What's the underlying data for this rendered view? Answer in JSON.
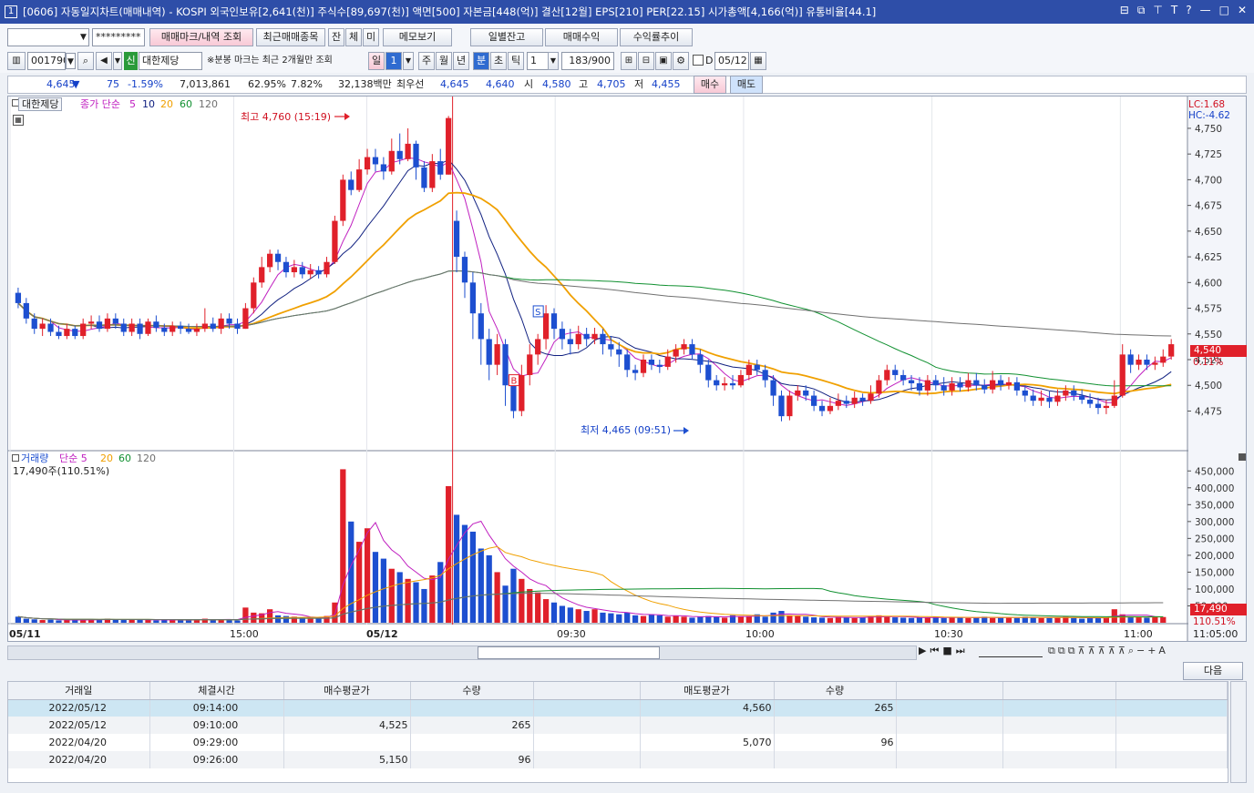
{
  "title_bar": {
    "window_number": "1",
    "title": "[0606] 자동일지차트(매매내역) - KOSPI 외국인보유[2,641(천)] 주식수[89,697(천)] 액면[500] 자본금[448(억)] 결산[12월] EPS[210] PER[22.15] 시가총액[4,166(억)] 유통비율[44.1]",
    "controls": [
      "⊟",
      "⧉",
      "⊤",
      "T",
      "?",
      "—",
      "□",
      "✕"
    ]
  },
  "toolbar1": {
    "account_value": "",
    "password_mask": "*********",
    "buttons": [
      "매매마크/내역 조회",
      "최근매매종목",
      "잔",
      "체",
      "미",
      "메모보기",
      "일별잔고",
      "매매수익",
      "수익률추이"
    ]
  },
  "toolbar2": {
    "stock_code": "001790",
    "stock_badge": "신",
    "stock_name": "대한제당",
    "note": "※분봉 마크는 최근 2개월만 조회",
    "periods": [
      "일",
      "1",
      "주",
      "월",
      "년",
      "분",
      "초",
      "틱",
      "1"
    ],
    "count": "183/900",
    "d_label": "D",
    "date": "05/12"
  },
  "quote": {
    "price": "4,645",
    "arrow": "▼",
    "change": "75",
    "change_pct": "-1.59%",
    "volume": "7,013,861",
    "ratio": "62.95%",
    "turnover": "7.82%",
    "amount": "32,138백만",
    "best_label": "최우선",
    "best_ask": "4,645",
    "best_bid": "4,640",
    "open_label": "시",
    "open": "4,580",
    "high_label": "고",
    "high": "4,705",
    "low_label": "저",
    "low": "4,455",
    "buy_btn": "매수",
    "sell_btn": "매도"
  },
  "price_panel": {
    "stock_tab": "대한제당",
    "legend_prefix": "종가 단순",
    "legend_ma": [
      "5",
      "10",
      "20",
      "60",
      "120"
    ],
    "lc": "LC:1.68",
    "hc": "HC:-4.62",
    "high_marker": "최고 4,760 (15:19)",
    "low_marker": "최저 4,465 (09:51)",
    "current_price": "4,540",
    "current_pct": "0.11%",
    "buy_mark": "B",
    "sell_mark": "S"
  },
  "volume_panel": {
    "legend_prefix": "거래량",
    "legend_ma": [
      "단순 5",
      "20",
      "60",
      "120"
    ],
    "info": "17,490주(110.51%)",
    "current_vol": "17,490",
    "current_pct": "110.51%"
  },
  "time_axis": [
    "05/11",
    "15:00",
    "05/12",
    "09:30",
    "10:00",
    "10:30",
    "11:00",
    "11:05:00"
  ],
  "bottom": {
    "next_btn": "다음"
  },
  "trade_table": {
    "headers": [
      "거래일",
      "체결시간",
      "매수평균가",
      "수량",
      "",
      "매도평균가",
      "수량",
      "",
      "",
      ""
    ],
    "rows": [
      [
        "2022/05/12",
        "09:14:00",
        "",
        "",
        "",
        "4,560",
        "265",
        "",
        "",
        ""
      ],
      [
        "2022/05/12",
        "09:10:00",
        "4,525",
        "265",
        "",
        "",
        "",
        "",
        "",
        ""
      ],
      [
        "2022/04/20",
        "09:29:00",
        "",
        "",
        "",
        "5,070",
        "96",
        "",
        "",
        ""
      ],
      [
        "2022/04/20",
        "09:26:00",
        "5,150",
        "96",
        "",
        "",
        "",
        "",
        "",
        ""
      ]
    ]
  },
  "chart_data": {
    "type": "candlestick",
    "price_axis": {
      "ticks": [
        4475,
        4500,
        4525,
        4550,
        4575,
        4600,
        4625,
        4650,
        4675,
        4700,
        4725,
        4750
      ],
      "ylim": [
        4440,
        4765
      ]
    },
    "volume_axis": {
      "ticks": [
        50000,
        100000,
        150000,
        200000,
        250000,
        300000,
        350000,
        400000,
        450000
      ],
      "ylim": [
        0,
        475000
      ]
    },
    "colors": {
      "up": "#e0202a",
      "down": "#1d4fd0",
      "ma5": "#c020c0",
      "ma10": "#102080",
      "ma20": "#f0a000",
      "ma60": "#109030",
      "ma120": "#707070"
    },
    "candles": [
      [
        4590,
        4580,
        4595,
        4575
      ],
      [
        4580,
        4565,
        4585,
        4560
      ],
      [
        4565,
        4555,
        4570,
        4550
      ],
      [
        4555,
        4560,
        4565,
        4548
      ],
      [
        4560,
        4552,
        4565,
        4548
      ],
      [
        4552,
        4548,
        4558,
        4545
      ],
      [
        4548,
        4555,
        4560,
        4545
      ],
      [
        4555,
        4548,
        4558,
        4545
      ],
      [
        4548,
        4560,
        4565,
        4545
      ],
      [
        4560,
        4562,
        4568,
        4555
      ],
      [
        4562,
        4555,
        4568,
        4552
      ],
      [
        4555,
        4565,
        4570,
        4552
      ],
      [
        4565,
        4560,
        4570,
        4555
      ],
      [
        4560,
        4552,
        4565,
        4548
      ],
      [
        4552,
        4560,
        4565,
        4548
      ],
      [
        4560,
        4550,
        4565,
        4545
      ],
      [
        4550,
        4562,
        4565,
        4548
      ],
      [
        4562,
        4556,
        4568,
        4552
      ],
      [
        4556,
        4552,
        4560,
        4548
      ],
      [
        4552,
        4558,
        4562,
        4548
      ],
      [
        4558,
        4555,
        4562,
        4550
      ],
      [
        4555,
        4552,
        4560,
        4550
      ],
      [
        4552,
        4555,
        4560,
        4548
      ],
      [
        4555,
        4560,
        4575,
        4552
      ],
      [
        4560,
        4555,
        4566,
        4552
      ],
      [
        4555,
        4565,
        4570,
        4550
      ],
      [
        4565,
        4560,
        4570,
        4555
      ],
      [
        4560,
        4555,
        4565,
        4550
      ],
      [
        4555,
        4575,
        4580,
        4555
      ],
      [
        4575,
        4600,
        4605,
        4570
      ],
      [
        4600,
        4615,
        4625,
        4595
      ],
      [
        4615,
        4628,
        4632,
        4610
      ],
      [
        4628,
        4620,
        4632,
        4612
      ],
      [
        4620,
        4610,
        4625,
        4605
      ],
      [
        4610,
        4615,
        4622,
        4605
      ],
      [
        4615,
        4608,
        4620,
        4604
      ],
      [
        4608,
        4612,
        4618,
        4604
      ],
      [
        4612,
        4608,
        4616,
        4604
      ],
      [
        4608,
        4620,
        4625,
        4605
      ],
      [
        4620,
        4660,
        4665,
        4618
      ],
      [
        4660,
        4700,
        4705,
        4655
      ],
      [
        4700,
        4690,
        4708,
        4685
      ],
      [
        4690,
        4710,
        4720,
        4688
      ],
      [
        4710,
        4722,
        4730,
        4705
      ],
      [
        4722,
        4715,
        4730,
        4708
      ],
      [
        4715,
        4708,
        4722,
        4700
      ],
      [
        4708,
        4728,
        4740,
        4705
      ],
      [
        4728,
        4720,
        4745,
        4715
      ],
      [
        4720,
        4735,
        4750,
        4718
      ],
      [
        4735,
        4712,
        4738,
        4700
      ],
      [
        4712,
        4692,
        4718,
        4688
      ],
      [
        4692,
        4718,
        4725,
        4688
      ],
      [
        4718,
        4705,
        4730,
        4700
      ],
      [
        4705,
        4760,
        4762,
        4705
      ],
      [
        4660,
        4625,
        4670,
        4610
      ],
      [
        4625,
        4600,
        4630,
        4585
      ],
      [
        4600,
        4570,
        4610,
        4545
      ],
      [
        4570,
        4545,
        4580,
        4520
      ],
      [
        4545,
        4520,
        4555,
        4505
      ],
      [
        4520,
        4540,
        4550,
        4510
      ],
      [
        4540,
        4500,
        4545,
        4480
      ],
      [
        4500,
        4475,
        4510,
        4468
      ],
      [
        4475,
        4510,
        4520,
        4470
      ],
      [
        4510,
        4530,
        4540,
        4500
      ],
      [
        4530,
        4545,
        4550,
        4520
      ],
      [
        4545,
        4570,
        4578,
        4535
      ],
      [
        4570,
        4555,
        4575,
        4545
      ],
      [
        4555,
        4545,
        4562,
        4535
      ],
      [
        4545,
        4540,
        4555,
        4530
      ],
      [
        4540,
        4550,
        4558,
        4535
      ],
      [
        4550,
        4545,
        4556,
        4538
      ],
      [
        4545,
        4550,
        4556,
        4540
      ],
      [
        4550,
        4540,
        4555,
        4530
      ],
      [
        4540,
        4535,
        4548,
        4528
      ],
      [
        4535,
        4530,
        4542,
        4518
      ],
      [
        4530,
        4515,
        4535,
        4508
      ],
      [
        4515,
        4512,
        4520,
        4505
      ],
      [
        4512,
        4525,
        4530,
        4508
      ],
      [
        4525,
        4520,
        4530,
        4515
      ],
      [
        4520,
        4518,
        4525,
        4512
      ],
      [
        4518,
        4528,
        4535,
        4515
      ],
      [
        4528,
        4535,
        4540,
        4522
      ],
      [
        4535,
        4540,
        4545,
        4530
      ],
      [
        4540,
        4530,
        4545,
        4525
      ],
      [
        4530,
        4520,
        4535,
        4512
      ],
      [
        4520,
        4505,
        4525,
        4498
      ],
      [
        4505,
        4500,
        4510,
        4495
      ],
      [
        4500,
        4502,
        4508,
        4495
      ],
      [
        4502,
        4500,
        4510,
        4496
      ],
      [
        4500,
        4510,
        4515,
        4498
      ],
      [
        4510,
        4520,
        4525,
        4505
      ],
      [
        4520,
        4515,
        4525,
        4510
      ],
      [
        4515,
        4505,
        4520,
        4498
      ],
      [
        4505,
        4490,
        4510,
        4480
      ],
      [
        4490,
        4470,
        4495,
        4465
      ],
      [
        4470,
        4490,
        4495,
        4466
      ],
      [
        4490,
        4495,
        4500,
        4485
      ],
      [
        4495,
        4490,
        4500,
        4485
      ],
      [
        4490,
        4480,
        4495,
        4475
      ],
      [
        4480,
        4475,
        4485,
        4470
      ],
      [
        4475,
        4480,
        4488,
        4472
      ],
      [
        4480,
        4485,
        4492,
        4476
      ],
      [
        4485,
        4482,
        4490,
        4478
      ],
      [
        4482,
        4488,
        4494,
        4478
      ],
      [
        4488,
        4485,
        4492,
        4480
      ],
      [
        4485,
        4492,
        4500,
        4482
      ],
      [
        4492,
        4505,
        4510,
        4488
      ],
      [
        4505,
        4515,
        4520,
        4500
      ],
      [
        4515,
        4510,
        4520,
        4505
      ],
      [
        4510,
        4505,
        4515,
        4500
      ],
      [
        4505,
        4502,
        4510,
        4495
      ],
      [
        4502,
        4495,
        4508,
        4490
      ],
      [
        4495,
        4505,
        4510,
        4490
      ],
      [
        4505,
        4500,
        4510,
        4495
      ],
      [
        4500,
        4495,
        4508,
        4490
      ],
      [
        4495,
        4502,
        4508,
        4490
      ],
      [
        4502,
        4498,
        4508,
        4494
      ],
      [
        4498,
        4505,
        4512,
        4494
      ],
      [
        4505,
        4500,
        4512,
        4495
      ],
      [
        4500,
        4496,
        4506,
        4492
      ],
      [
        4496,
        4505,
        4514,
        4492
      ],
      [
        4505,
        4500,
        4510,
        4495
      ],
      [
        4500,
        4503,
        4508,
        4496
      ],
      [
        4503,
        4495,
        4508,
        4490
      ],
      [
        4495,
        4490,
        4500,
        4484
      ],
      [
        4490,
        4485,
        4496,
        4480
      ],
      [
        4485,
        4488,
        4495,
        4480
      ],
      [
        4488,
        4484,
        4494,
        4478
      ],
      [
        4484,
        4490,
        4496,
        4480
      ],
      [
        4490,
        4495,
        4500,
        4485
      ],
      [
        4495,
        4490,
        4500,
        4485
      ],
      [
        4490,
        4486,
        4496,
        4482
      ],
      [
        4486,
        4482,
        4492,
        4478
      ],
      [
        4482,
        4478,
        4488,
        4472
      ],
      [
        4478,
        4480,
        4486,
        4472
      ],
      [
        4480,
        4490,
        4505,
        4478
      ],
      [
        4490,
        4530,
        4540,
        4488
      ],
      [
        4530,
        4520,
        4535,
        4512
      ],
      [
        4520,
        4525,
        4530,
        4515
      ],
      [
        4525,
        4520,
        4530,
        4515
      ],
      [
        4520,
        4522,
        4528,
        4515
      ],
      [
        4522,
        4528,
        4535,
        4518
      ],
      [
        4528,
        4540,
        4545,
        4525
      ]
    ],
    "volume": [
      18,
      12,
      10,
      8,
      9,
      7,
      8,
      9,
      8,
      10,
      8,
      12,
      9,
      8,
      10,
      8,
      9,
      7,
      8,
      9,
      8,
      7,
      9,
      12,
      9,
      10,
      8,
      7,
      45,
      30,
      28,
      40,
      22,
      20,
      18,
      15,
      12,
      14,
      20,
      60,
      455,
      300,
      240,
      280,
      210,
      190,
      160,
      150,
      130,
      120,
      100,
      140,
      180,
      405,
      320,
      290,
      270,
      220,
      200,
      150,
      110,
      160,
      130,
      100,
      90,
      70,
      60,
      50,
      45,
      40,
      35,
      40,
      30,
      28,
      25,
      30,
      22,
      20,
      25,
      22,
      18,
      20,
      18,
      15,
      18,
      20,
      18,
      15,
      22,
      18,
      20,
      25,
      18,
      30,
      35,
      22,
      20,
      18,
      16,
      15,
      14,
      18,
      16,
      14,
      15,
      20,
      22,
      18,
      16,
      15,
      14,
      15,
      16,
      18,
      14,
      15,
      16,
      14,
      15,
      18,
      14,
      15,
      16,
      14,
      18,
      15,
      14,
      16,
      15,
      18,
      14,
      12,
      14,
      16,
      15,
      40,
      25,
      18,
      16,
      15,
      18,
      17
    ]
  }
}
